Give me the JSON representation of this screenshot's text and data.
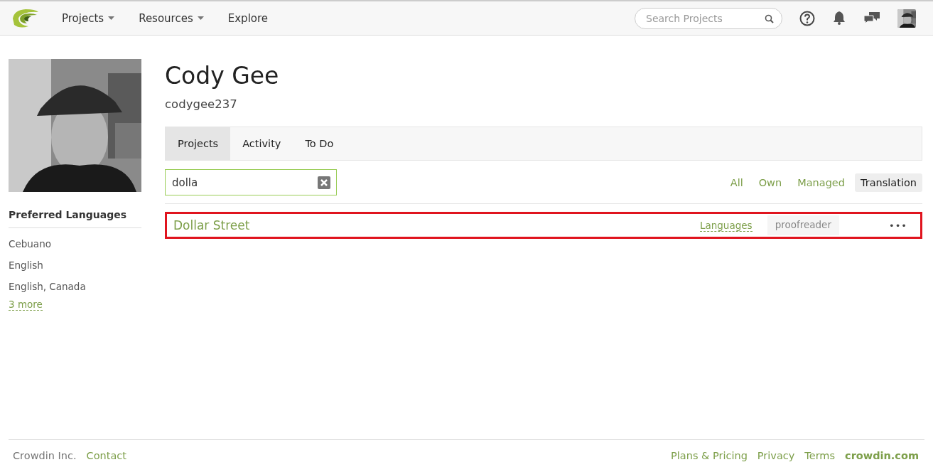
{
  "nav": {
    "menus": [
      {
        "label": "Projects",
        "dropdown": true
      },
      {
        "label": "Resources",
        "dropdown": true
      },
      {
        "label": "Explore",
        "dropdown": false
      }
    ],
    "search": {
      "placeholder": "Search Projects"
    }
  },
  "profile": {
    "name": "Cody Gee",
    "username": "codygee237"
  },
  "preferred_languages": {
    "title": "Preferred Languages",
    "items": [
      "Cebuano",
      "English",
      "English, Canada"
    ],
    "more": "3 more"
  },
  "tabs": [
    {
      "label": "Projects",
      "selected": true
    },
    {
      "label": "Activity",
      "selected": false
    },
    {
      "label": "To Do",
      "selected": false
    }
  ],
  "filter": {
    "value": "dolla"
  },
  "filters": [
    {
      "label": "All",
      "selected": false
    },
    {
      "label": "Own",
      "selected": false
    },
    {
      "label": "Managed",
      "selected": false
    },
    {
      "label": "Translation",
      "selected": true
    }
  ],
  "projects": [
    {
      "name": "Dollar Street",
      "languages": "Languages",
      "role": "proofreader",
      "more": "•••",
      "highlighted": true
    }
  ],
  "footer": {
    "left": [
      {
        "label": "Crowdin Inc.",
        "kind": "text"
      },
      {
        "label": "Contact",
        "kind": "link"
      }
    ],
    "right": [
      {
        "label": "Plans & Pricing",
        "kind": "link"
      },
      {
        "label": "Privacy",
        "kind": "link"
      },
      {
        "label": "Terms",
        "kind": "link"
      },
      {
        "label": "crowdin.com",
        "kind": "brand"
      }
    ]
  }
}
